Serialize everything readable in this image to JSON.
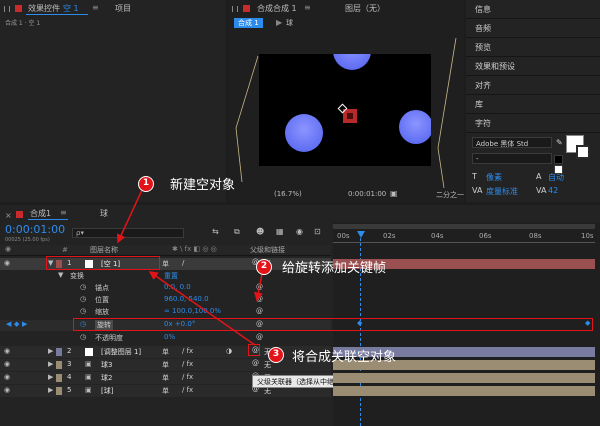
{
  "project_panel": {
    "tab_effects": "效果控件",
    "tab_effects_target": "空 1",
    "tab_project": "项目",
    "breadcrumb": "合成 1 · 空 1"
  },
  "comp_panel": {
    "tab_label": "合成",
    "tab_name": "合成 1",
    "crumb_comp": "合成 1",
    "crumb_layer": "球",
    "layer_panel_label": "图层（无）",
    "zoom": "(16.7%)",
    "timecode": "0:00:01:00",
    "resolution": "二分之一"
  },
  "right_panel": {
    "items": [
      "信息",
      "音频",
      "预览",
      "效果和预设",
      "对齐",
      "库"
    ],
    "char_title": "字符",
    "font_name": "Adobe 黑体 Std",
    "font_style": "-",
    "size_unit": "像素",
    "size_label": "自动",
    "tracking_label": "度量标准",
    "tracking_value": "42"
  },
  "timeline": {
    "tab_comp": "合成1",
    "tab_ball": "球",
    "current_time": "0:00:01:00",
    "frame_info": "00025 (25.00 fps)",
    "search_placeholder": "ρ▾",
    "col_layer_name": "图层名称",
    "col_parent": "父级和链接",
    "ruler": [
      "00s",
      "02s",
      "04s",
      "06s",
      "08s",
      "10s"
    ],
    "layers": [
      {
        "num": "1",
        "name": "[空 1]",
        "mode": "单",
        "parent": "无"
      },
      {
        "num": "2",
        "name": "[调整图层 1]",
        "mode": "单",
        "parent": "无"
      },
      {
        "num": "3",
        "name": "球3",
        "mode": "单",
        "parent": "无"
      },
      {
        "num": "4",
        "name": "球2",
        "mode": "单",
        "parent": "无"
      },
      {
        "num": "5",
        "name": "[球]",
        "mode": "单",
        "parent": "无"
      }
    ],
    "transform_label": "变换",
    "transform_reset": "重置",
    "props": [
      {
        "name": "锚点",
        "value": "0.0, 0.0"
      },
      {
        "name": "位置",
        "value": "960.0, 540.0"
      },
      {
        "name": "缩放",
        "value": "∞ 100.0,100.0%"
      },
      {
        "name": "旋转",
        "value": "0x +0.0°"
      },
      {
        "name": "不透明度",
        "value": "0%"
      }
    ],
    "tooltip": "父级关联器（选择从中继承变换的图层）"
  },
  "annotations": [
    {
      "num": "1",
      "text": "新建空对象"
    },
    {
      "num": "2",
      "text": "给旋转添加关键帧"
    },
    {
      "num": "3",
      "text": "将合成关联空对象"
    }
  ],
  "colors": {
    "accent_blue": "#2d8ceb",
    "annotation_red": "#e2141a",
    "ball_blue": "#6f7dff",
    "layer_tan": "#9b8c74",
    "layer_red": "#9a5050",
    "layer_lavender": "#787aa0"
  }
}
